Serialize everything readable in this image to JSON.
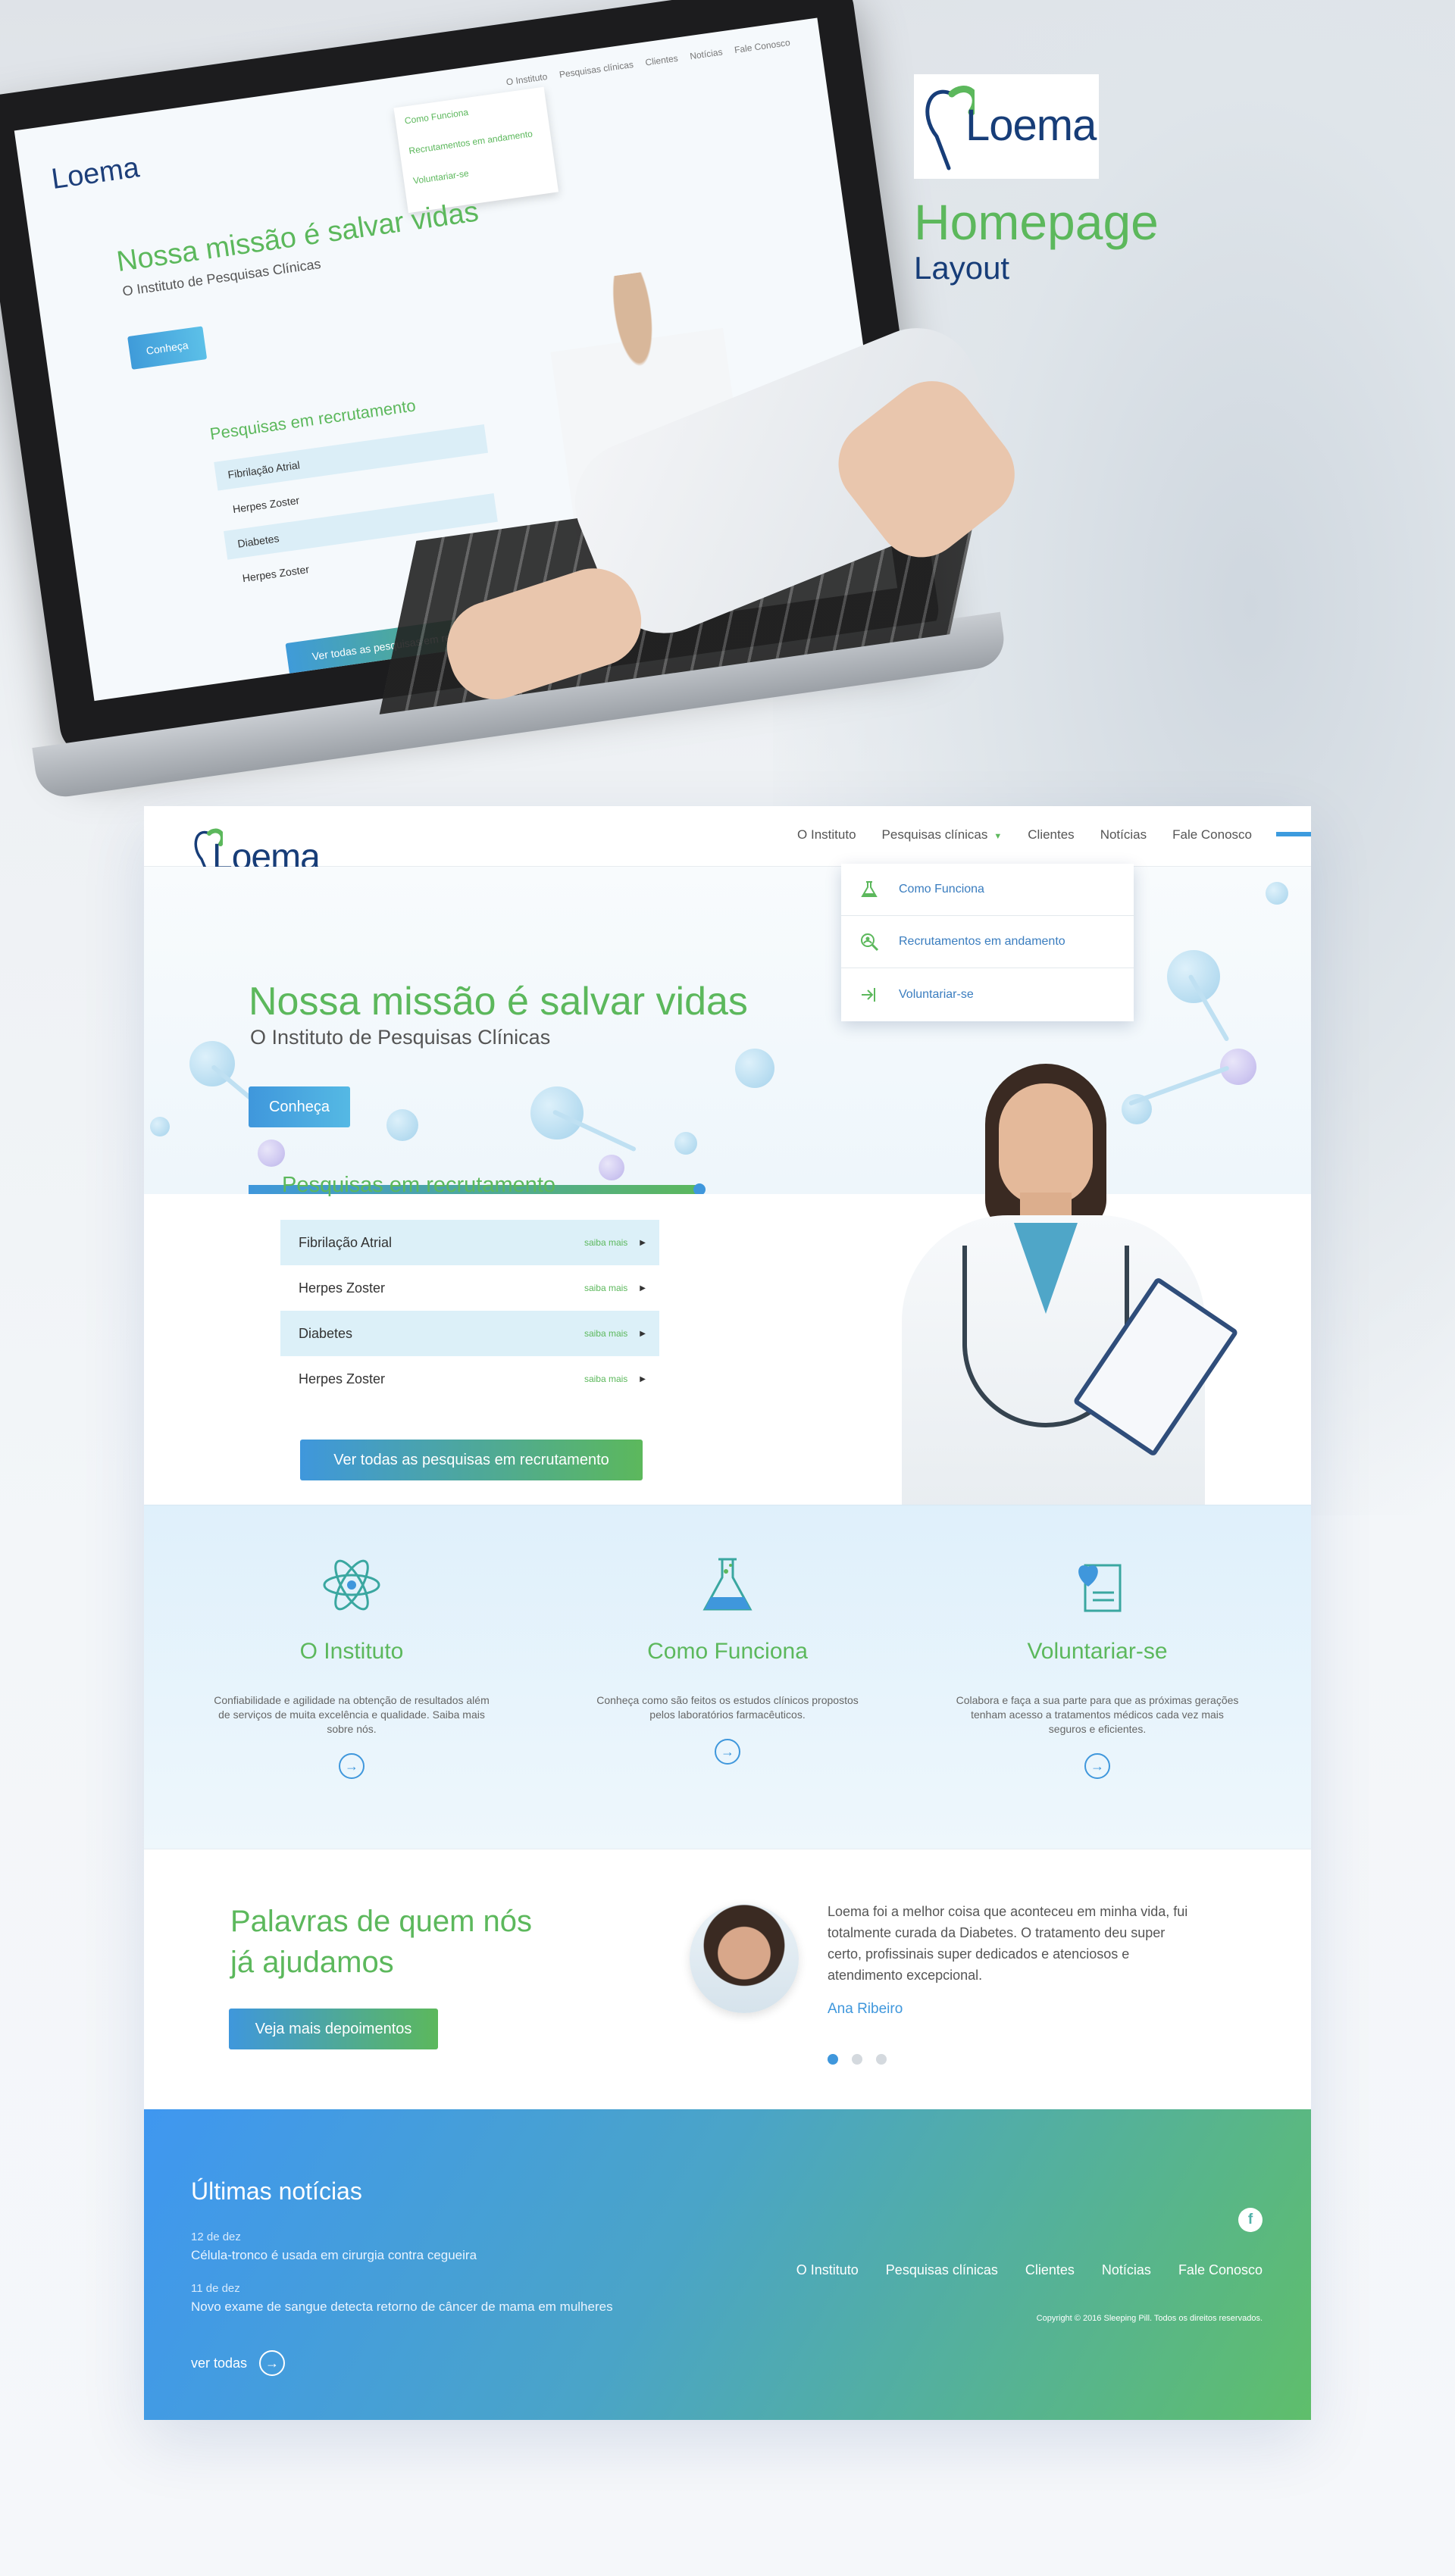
{
  "showcase": {
    "logo": "Loema",
    "title": "Homepage",
    "subtitle": "Layout"
  },
  "laptop": {
    "nav": [
      "O Instituto",
      "Pesquisas clínicas",
      "Clientes",
      "Notícias",
      "Fale Conosco"
    ],
    "dropdown": [
      "Como Funciona",
      "Recrutamentos em andamento",
      "Voluntariar-se"
    ],
    "logo": "Loema",
    "hero_title": "Nossa missão é salvar vidas",
    "hero_subtitle": "O Instituto de Pesquisas Clínicas",
    "hero_button": "Conheça",
    "list_title": "Pesquisas em recrutamento",
    "rows": [
      "Fibrilação Atrial",
      "Herpes Zoster",
      "Diabetes",
      "Herpes Zoster"
    ],
    "cta": "Ver todas as pesquisas em recrutamento"
  },
  "header": {
    "logo": "Loema",
    "nav": [
      "O Instituto",
      "Pesquisas clínicas",
      "Clientes",
      "Notícias",
      "Fale Conosco"
    ],
    "dropdown": [
      {
        "label": "Como Funciona",
        "icon": "flask-icon"
      },
      {
        "label": "Recrutamentos em andamento",
        "icon": "search-person-icon"
      },
      {
        "label": "Voluntariar-se",
        "icon": "login-arrow-icon"
      }
    ]
  },
  "hero": {
    "title": "Nossa missão é salvar vidas",
    "subtitle": "O Instituto de Pesquisas Clínicas",
    "button": "Conheça"
  },
  "recruitment": {
    "title": "Pesquisas em recrutamento",
    "more_label": "saiba mais",
    "rows": [
      "Fibrilação Atrial",
      "Herpes Zoster",
      "Diabetes",
      "Herpes Zoster"
    ],
    "cta": "Ver todas as pesquisas em recrutamento"
  },
  "features": [
    {
      "icon": "atom-icon",
      "title": "O Instituto",
      "text": "Confiabilidade e agilidade na obtenção de resultados além de serviços de muita excelência e qualidade. Saiba mais sobre nós."
    },
    {
      "icon": "flask-icon",
      "title": "Como Funciona",
      "text": "Conheça como são feitos os estudos clínicos propostos pelos laboratórios farmacêuticos."
    },
    {
      "icon": "heart-document-icon",
      "title": "Voluntariar-se",
      "text": "Colabora e faça a sua parte para que as próximas gerações tenham acesso a tratamentos médicos cada vez mais seguros e eficientes."
    }
  ],
  "testimonials": {
    "title": "Palavras de quem nós já ajudamos",
    "button": "Veja mais depoimentos",
    "quote": "Loema foi a melhor coisa que aconteceu em minha vida, fui totalmente curada da Diabetes. O tratamento deu super certo, profissinais super dedicados e atenciosos e atendimento excepcional.",
    "name": "Ana Ribeiro",
    "active_dot": 0,
    "dots": 3
  },
  "footer": {
    "news_title": "Últimas notícias",
    "news": [
      {
        "date": "12 de dez",
        "text": "Célula-tronco é usada em cirurgia contra cegueira"
      },
      {
        "date": "11 de dez",
        "text": "Novo exame de sangue detecta retorno de câncer de mama em mulheres"
      }
    ],
    "see_all": "ver todas",
    "nav": [
      "O Instituto",
      "Pesquisas clínicas",
      "Clientes",
      "Notícias",
      "Fale Conosco"
    ],
    "facebook": "f",
    "copyright": "Copyright © 2016 Sleeping Pill. Todos os direitos reservados."
  },
  "colors": {
    "green": "#5cb85c",
    "blue": "#3f97dc",
    "navy": "#173d78"
  }
}
